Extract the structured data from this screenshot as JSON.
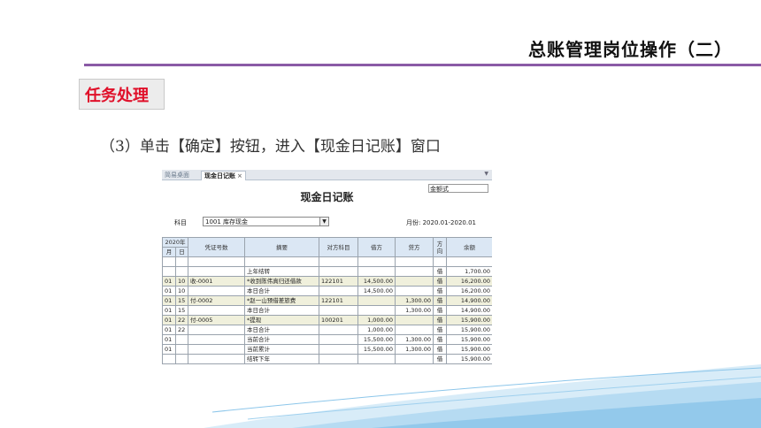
{
  "slide": {
    "title": "总账管理岗位操作（二）",
    "task_label": "任务处理",
    "step_text": "（3）单击【确定】按钮，进入【现金日记账】窗口"
  },
  "window": {
    "tabs": [
      {
        "label": "简易桌面"
      },
      {
        "label": "现金日记账",
        "close": "×"
      }
    ],
    "format_select": "金额式",
    "title": "现金日记账",
    "subject_label": "科目",
    "subject_value": "1001 库存现金",
    "period": "月份: 2020.01-2020.01"
  },
  "table": {
    "header": {
      "year": "2020年",
      "month": "月",
      "day": "日",
      "voucher": "凭证号数",
      "summary": "摘要",
      "counter": "对方科目",
      "debit": "借方",
      "credit": "贷方",
      "direction": "方向",
      "balance": "余额"
    },
    "rows": [
      {
        "m": "",
        "d": "",
        "v": "",
        "s": "",
        "c": "",
        "dr": "",
        "cr": "",
        "dir": "",
        "bal": ""
      },
      {
        "m": "",
        "d": "",
        "v": "",
        "s": "上年结转",
        "c": "",
        "dr": "",
        "cr": "",
        "dir": "借",
        "bal": "1,700.00"
      },
      {
        "m": "01",
        "d": "10",
        "v": "收-0001",
        "s": "*收到陈伟真归还借款",
        "c": "122101",
        "dr": "14,500.00",
        "cr": "",
        "dir": "借",
        "bal": "16,200.00",
        "hl": true
      },
      {
        "m": "01",
        "d": "10",
        "v": "",
        "s": "本日合计",
        "c": "",
        "dr": "14,500.00",
        "cr": "",
        "dir": "借",
        "bal": "16,200.00"
      },
      {
        "m": "01",
        "d": "15",
        "v": "付-0002",
        "s": "*赵一山预借差旅费",
        "c": "122101",
        "dr": "",
        "cr": "1,300.00",
        "dir": "借",
        "bal": "14,900.00",
        "hl": true
      },
      {
        "m": "01",
        "d": "15",
        "v": "",
        "s": "本日合计",
        "c": "",
        "dr": "",
        "cr": "1,300.00",
        "dir": "借",
        "bal": "14,900.00"
      },
      {
        "m": "01",
        "d": "22",
        "v": "付-0005",
        "s": "*提现",
        "c": "100201",
        "dr": "1,000.00",
        "cr": "",
        "dir": "借",
        "bal": "15,900.00",
        "hl": true
      },
      {
        "m": "01",
        "d": "22",
        "v": "",
        "s": "本日合计",
        "c": "",
        "dr": "1,000.00",
        "cr": "",
        "dir": "借",
        "bal": "15,900.00"
      },
      {
        "m": "01",
        "d": "",
        "v": "",
        "s": "当前合计",
        "c": "",
        "dr": "15,500.00",
        "cr": "1,300.00",
        "dir": "借",
        "bal": "15,900.00"
      },
      {
        "m": "01",
        "d": "",
        "v": "",
        "s": "当前累计",
        "c": "",
        "dr": "15,500.00",
        "cr": "1,300.00",
        "dir": "借",
        "bal": "15,900.00"
      },
      {
        "m": "",
        "d": "",
        "v": "",
        "s": "结转下年",
        "c": "",
        "dr": "",
        "cr": "",
        "dir": "借",
        "bal": "15,900.00"
      }
    ]
  },
  "colors": {
    "title_rule": "#8a5aa6",
    "task_text": "#e0102a",
    "header_bg": "#dbe7f4",
    "highlight_row": "#f0f0dc",
    "wave": "#8cc6ea"
  }
}
